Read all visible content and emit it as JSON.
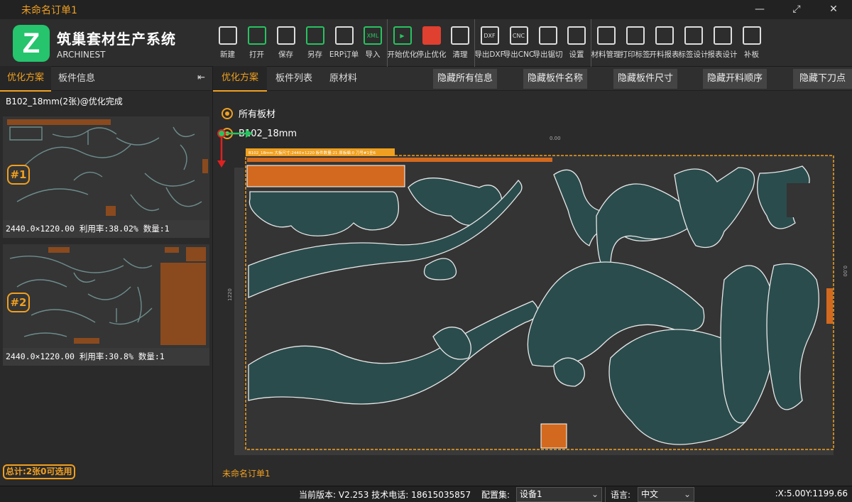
{
  "window": {
    "title": "未命名订单1"
  },
  "brand": {
    "name_cn": "筑巢套材生产系统",
    "name_en": "ARCHINEST",
    "logo_letter": "Z"
  },
  "toolbar": [
    {
      "label": "新建",
      "icon": "new-file-icon"
    },
    {
      "label": "打开",
      "icon": "folder-open-icon"
    },
    {
      "label": "保存",
      "icon": "save-icon"
    },
    {
      "label": "另存",
      "icon": "save-as-icon"
    },
    {
      "label": "ERP订单",
      "icon": "erp-list-icon"
    },
    {
      "label": "导入",
      "icon": "xml-import-icon",
      "badge": "XML"
    },
    {
      "label": "开始优化",
      "icon": "play-icon"
    },
    {
      "label": "停止优化",
      "icon": "stop-icon"
    },
    {
      "label": "清理",
      "icon": "broom-icon"
    },
    {
      "label": "导出DXF",
      "icon": "dxf-export-icon",
      "badge": "DXF"
    },
    {
      "label": "导出CNC",
      "icon": "cnc-export-icon",
      "badge": "CNC"
    },
    {
      "label": "导出锯切",
      "icon": "saw-export-icon"
    },
    {
      "label": "设置",
      "icon": "gear-icon"
    },
    {
      "label": "材料管理",
      "icon": "layers-icon"
    },
    {
      "label": "打印标签",
      "icon": "printer-icon"
    },
    {
      "label": "开料报表",
      "icon": "report-icon"
    },
    {
      "label": "标签设计",
      "icon": "barcode-icon"
    },
    {
      "label": "报表设计",
      "icon": "chart-design-icon"
    },
    {
      "label": "补板",
      "icon": "patch-board-icon"
    }
  ],
  "left_panel": {
    "tabs": [
      "优化方案",
      "板件信息"
    ],
    "collapse_glyph": "⇤",
    "group_title": "B102_18mm(2张)@优化完成",
    "sheets": [
      {
        "badge": "#1",
        "info": "2440.0×1220.00 利用率:38.02% 数量:1"
      },
      {
        "badge": "#2",
        "info": "2440.0×1220.00 利用率:30.8% 数量:1"
      }
    ],
    "total": "总计:2张0可选用"
  },
  "main": {
    "tabs": [
      "优化方案",
      "板件列表",
      "原材料"
    ],
    "hide_buttons": [
      "隐藏所有信息",
      "隐藏板件名称",
      "隐藏板件尺寸",
      "隐藏开料顺序",
      "隐藏下刀点"
    ],
    "radio_all": "所有板材",
    "radio_material": "B102_18mm",
    "board_header": "B102_18mm 大板尺寸:2440×1220 板件数量:21 原板编:0 刀号#1全6",
    "ruler_top_label": "0.00",
    "ruler_left_label": "1220",
    "ruler_right_label": "0.00",
    "order_name": "未命名订单1"
  },
  "statusbar": {
    "version": "当前版本: V2.253 技术电话: 18615035857",
    "config_label": "配置集:",
    "config_value": "设备1",
    "lang_label": "语言:",
    "lang_value": "中文",
    "coords": ":X:5.00Y:1199.66"
  },
  "colors": {
    "accent": "#f0a020",
    "part_fill": "#2b4c4c",
    "offcut": "#d2691e",
    "logo": "#25c46d"
  }
}
